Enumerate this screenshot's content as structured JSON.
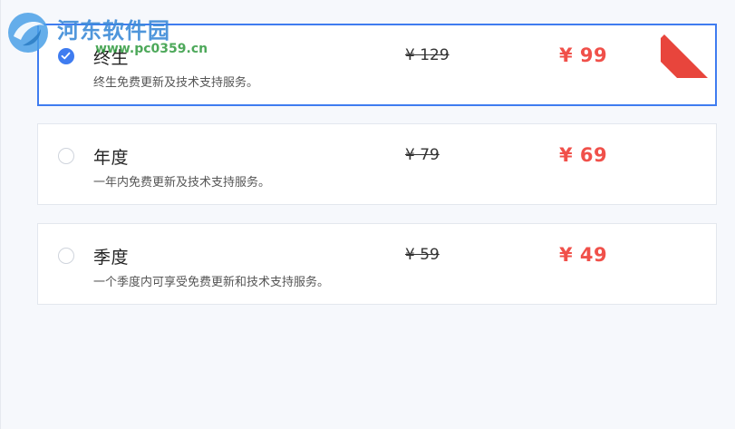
{
  "plans": [
    {
      "name": "终生",
      "description": "终生免费更新及技术支持服务。",
      "original_price": "¥ 129",
      "price": "¥ 99",
      "selected": true
    },
    {
      "name": "年度",
      "description": "一年内免费更新及技术支持服务。",
      "original_price": "¥ 79",
      "price": "¥ 69",
      "selected": false
    },
    {
      "name": "季度",
      "description": "一个季度内可享受免费更新和技术支持服务。",
      "original_price": "¥ 59",
      "price": "¥ 49",
      "selected": false
    }
  ],
  "watermark": {
    "title": "河东软件园",
    "url": "www.pc0359.cn"
  },
  "colors": {
    "accent": "#3f7cf0",
    "price": "#f0504a",
    "ribbon": "#e8453c",
    "background": "#f6f8fc"
  },
  "icons": {
    "radio_checked": "check-icon",
    "ribbon": "fire-icon"
  }
}
